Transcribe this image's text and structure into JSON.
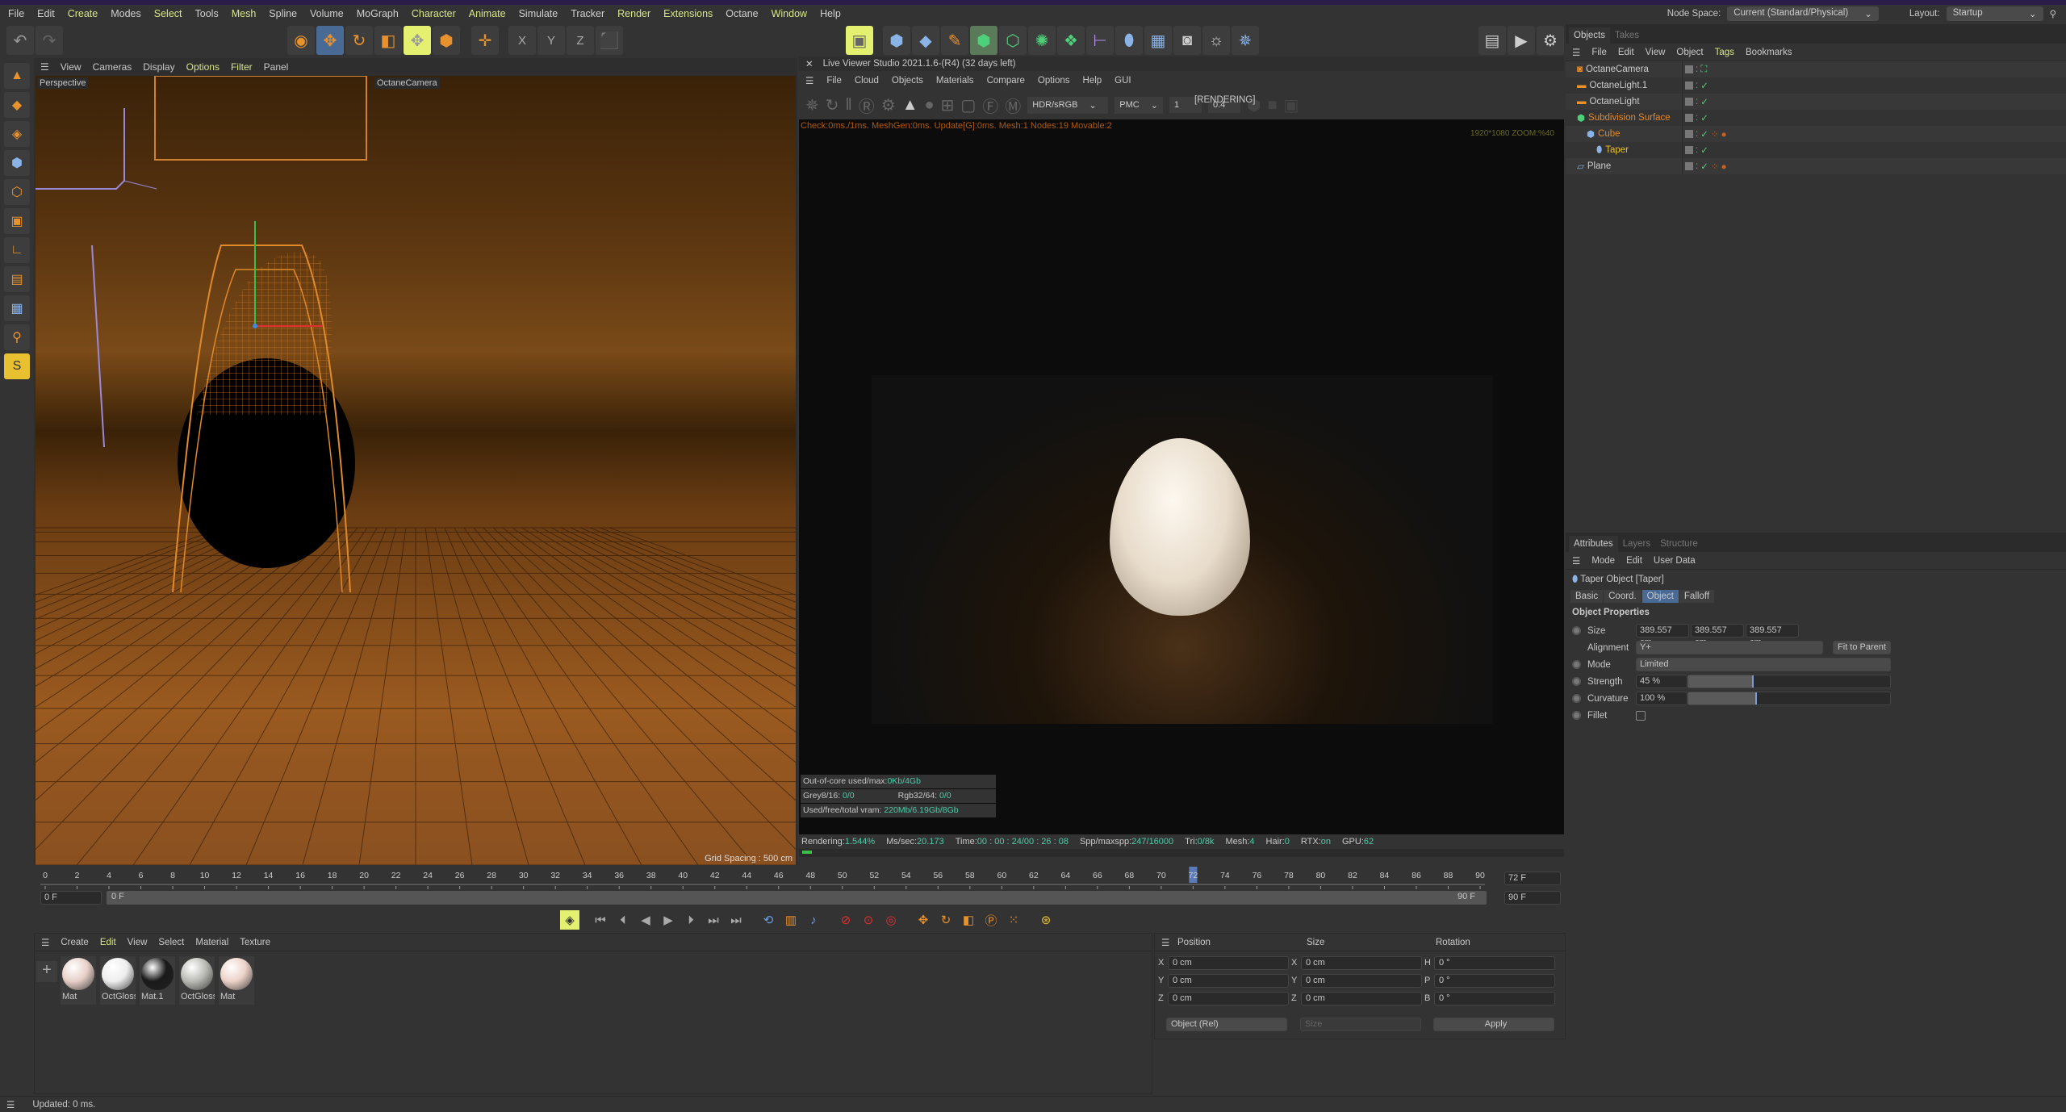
{
  "menu": [
    "File",
    "Edit",
    "Create",
    "Modes",
    "Select",
    "Tools",
    "Mesh",
    "Spline",
    "Volume",
    "MoGraph",
    "Character",
    "Animate",
    "Simulate",
    "Tracker",
    "Render",
    "Extensions",
    "Octane",
    "Window",
    "Help"
  ],
  "node_space": {
    "label": "Node Space:",
    "value": "Current (Standard/Physical)"
  },
  "layout": {
    "label": "Layout:",
    "value": "Startup"
  },
  "viewport": {
    "menu": [
      "View",
      "Cameras",
      "Display",
      "Options",
      "Filter",
      "Panel"
    ],
    "name": "Perspective",
    "camera": "OctaneCamera",
    "grid_spacing": "Grid Spacing : 500 cm"
  },
  "live_viewer": {
    "title": "Live Viewer Studio 2021.1.6-(R4) (32 days left)",
    "menu": [
      "File",
      "Cloud",
      "Objects",
      "Materials",
      "Compare",
      "Options",
      "Help",
      "GUI"
    ],
    "state": "[RENDERING]",
    "tonemap": "HDR/sRGB",
    "kernel": "PMC",
    "value1": "1",
    "value2": "0.4",
    "status": "Check:0ms./1ms. MeshGen:0ms. Update[G]:0ms. Mesh:1 Nodes:19 Movable:2",
    "resolution": "1920*1080 ZOOM:%40",
    "stats": {
      "ooc_label": "Out-of-core used/max:",
      "ooc": "0Kb/4Gb",
      "grey_label": "Grey8/16:",
      "grey": "0/0",
      "rgb_label": "Rgb32/64:",
      "rgb": "0/0",
      "vram_label": "Used/free/total vram:",
      "vram": "220Mb/6.19Gb/8Gb"
    },
    "bottom": {
      "rendering_label": "Rendering:",
      "rendering": "1.544%",
      "ms_label": "Ms/sec:",
      "ms": "20.173",
      "time_label": "Time:",
      "time": "00 : 00 : 24/00 : 26 : 08",
      "spp_label": "Spp/maxspp:",
      "spp": "247/16000",
      "tri_label": "Tri:",
      "tri": "0/8k",
      "mesh_label": "Mesh:",
      "mesh": "4",
      "hair_label": "Hair:",
      "hair": "0",
      "rtx_label": "RTX:",
      "rtx": "on",
      "gpu_label": "GPU:",
      "gpu": "62"
    }
  },
  "objects": {
    "tabs": [
      "Objects",
      "Takes"
    ],
    "menu": [
      "File",
      "Edit",
      "View",
      "Object",
      "Tags",
      "Bookmarks"
    ],
    "items": [
      {
        "name": "OctaneCamera",
        "color": "#cccccc",
        "indent": 0
      },
      {
        "name": "OctaneLight.1",
        "color": "#cccccc",
        "indent": 0
      },
      {
        "name": "OctaneLight",
        "color": "#cccccc",
        "indent": 0
      },
      {
        "name": "Subdivision Surface",
        "color": "#e0882e",
        "indent": 0
      },
      {
        "name": "Cube",
        "color": "#e0882e",
        "indent": 1
      },
      {
        "name": "Taper",
        "color": "#e8c030",
        "indent": 2
      },
      {
        "name": "Plane",
        "color": "#cccccc",
        "indent": 0
      }
    ]
  },
  "attributes": {
    "tabs": [
      "Attributes",
      "Layers",
      "Structure"
    ],
    "menu": [
      "Mode",
      "Edit",
      "User Data"
    ],
    "title": "Taper Object [Taper]",
    "subtabs": [
      "Basic",
      "Coord.",
      "Object",
      "Falloff"
    ],
    "active_subtab": "Object",
    "section": "Object Properties",
    "size_label": "Size",
    "size": [
      "389.557 cm",
      "389.557 cm",
      "389.557 cm"
    ],
    "alignment_label": "Alignment",
    "alignment": "Y+",
    "fit_button": "Fit to Parent",
    "mode_label": "Mode",
    "mode": "Limited",
    "strength_label": "Strength",
    "strength": "45 %",
    "strength_value": 45,
    "curvature_label": "Curvature",
    "curvature": "100 %",
    "curvature_value": 100,
    "fillet_label": "Fillet",
    "fillet": false
  },
  "timeline": {
    "start": 0,
    "end": 90,
    "step": 2,
    "current": 72,
    "current_field": "72 F",
    "min_field": "0 F",
    "range_start": "0 F",
    "range_end": "90 F",
    "max_field": "90 F"
  },
  "materials": {
    "menu": [
      "Create",
      "Edit",
      "View",
      "Select",
      "Material",
      "Texture"
    ],
    "items": [
      {
        "name": "Mat",
        "color": "#e8d0c8"
      },
      {
        "name": "OctGloss",
        "color": "#eeeeee"
      },
      {
        "name": "Mat.1",
        "color": "#1a1a1a"
      },
      {
        "name": "OctGloss",
        "color": "#bbbbb5"
      },
      {
        "name": "Mat",
        "color": "#ecd2c8"
      }
    ]
  },
  "coords": {
    "headers": [
      "Position",
      "Size",
      "Rotation"
    ],
    "rows": [
      [
        "X",
        "0 cm",
        "X",
        "0 cm",
        "H",
        "0 °"
      ],
      [
        "Y",
        "0 cm",
        "Y",
        "0 cm",
        "P",
        "0 °"
      ],
      [
        "Z",
        "0 cm",
        "Z",
        "0 cm",
        "B",
        "0 °"
      ]
    ],
    "mode": "Object (Rel)",
    "size_mode": "Size",
    "apply": "Apply"
  },
  "status": "Updated: 0 ms."
}
